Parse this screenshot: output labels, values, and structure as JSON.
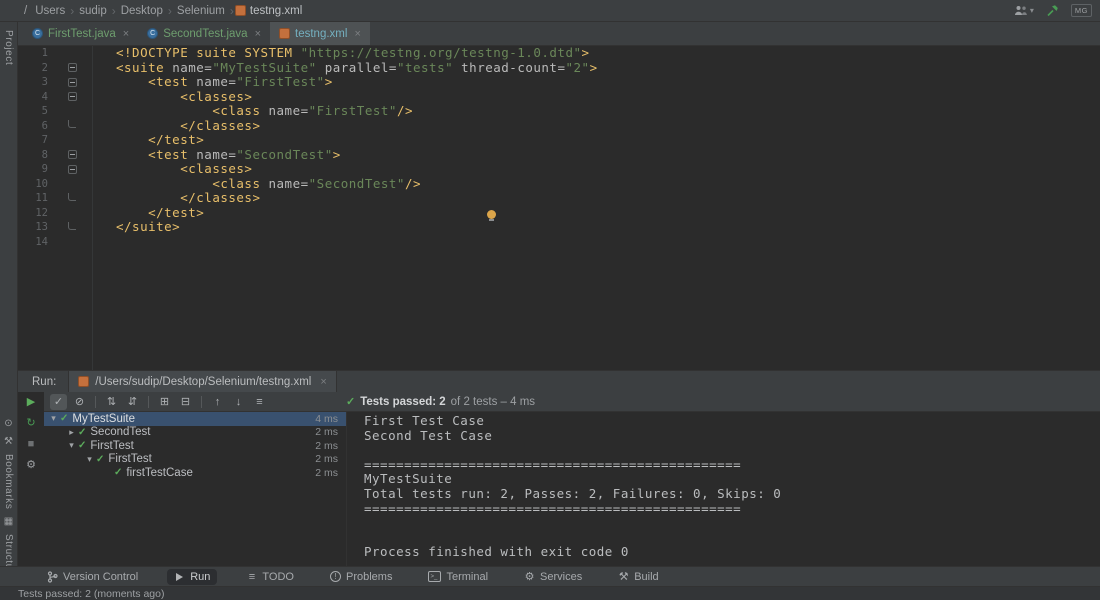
{
  "breadcrumb": {
    "items": [
      "/",
      "Users",
      "sudip",
      "Desktop",
      "Selenium",
      "testng.xml"
    ]
  },
  "top_right": {
    "badge": "MG"
  },
  "tabs": [
    {
      "label": "FirstTest.java",
      "icon": "class",
      "active": false,
      "label_color": "#6e9e6e"
    },
    {
      "label": "SecondTest.java",
      "icon": "class",
      "active": false,
      "label_color": "#6e9e6e"
    },
    {
      "label": "testng.xml",
      "icon": "testng",
      "active": true,
      "label_color": "#74b0c0"
    }
  ],
  "stripe": {
    "top_label": "Project",
    "bottom": [
      {
        "type": "icon",
        "name": "commit-icon",
        "glyph": "⊙"
      },
      {
        "type": "icon",
        "name": "build-icon",
        "glyph": "⚒"
      },
      {
        "type": "label",
        "name": "tool-stripe-bookmarks",
        "text": "Bookmarks"
      },
      {
        "type": "icon",
        "name": "layers-icon",
        "glyph": "▦"
      },
      {
        "type": "label",
        "name": "tool-stripe-structure",
        "text": "Structure"
      }
    ]
  },
  "editor": {
    "lines": [
      {
        "num": "1",
        "fold": "",
        "tokens": [
          [
            "tag",
            "<!DOCTYPE suite SYSTEM "
          ],
          [
            "str",
            "\"https://testng.org/testng-1.0.dtd\""
          ],
          [
            "tag",
            ">"
          ]
        ]
      },
      {
        "num": "2",
        "fold": "minus",
        "tokens": [
          [
            "tag",
            "<suite "
          ],
          [
            "attr",
            "name="
          ],
          [
            "str",
            "\"MyTestSuite\""
          ],
          [
            "attr",
            " parallel="
          ],
          [
            "str",
            "\"tests\""
          ],
          [
            "attr",
            " thread-count="
          ],
          [
            "str",
            "\"2\""
          ],
          [
            "tag",
            ">"
          ]
        ]
      },
      {
        "num": "3",
        "fold": "minus",
        "tokens": [
          [
            "plain",
            "    "
          ],
          [
            "tag",
            "<test "
          ],
          [
            "attr",
            "name="
          ],
          [
            "str",
            "\"FirstTest\""
          ],
          [
            "tag",
            ">"
          ]
        ]
      },
      {
        "num": "4",
        "fold": "minus",
        "tokens": [
          [
            "plain",
            "        "
          ],
          [
            "tag",
            "<classes>"
          ]
        ]
      },
      {
        "num": "5",
        "fold": "",
        "tokens": [
          [
            "plain",
            "            "
          ],
          [
            "tag",
            "<class "
          ],
          [
            "attr",
            "name="
          ],
          [
            "str",
            "\"FirstTest\""
          ],
          [
            "tag",
            "/>"
          ]
        ]
      },
      {
        "num": "6",
        "fold": "end",
        "tokens": [
          [
            "plain",
            "        "
          ],
          [
            "tag",
            "</classes>"
          ]
        ]
      },
      {
        "num": "7",
        "fold": "",
        "tokens": [
          [
            "plain",
            "    "
          ],
          [
            "tag",
            "</test>"
          ]
        ]
      },
      {
        "num": "8",
        "fold": "minus",
        "tokens": [
          [
            "plain",
            "    "
          ],
          [
            "tag",
            "<test "
          ],
          [
            "attr",
            "name="
          ],
          [
            "str",
            "\"SecondTest\""
          ],
          [
            "tag",
            ">"
          ]
        ]
      },
      {
        "num": "9",
        "fold": "minus",
        "tokens": [
          [
            "plain",
            "        "
          ],
          [
            "tag",
            "<classes>"
          ]
        ]
      },
      {
        "num": "10",
        "fold": "",
        "tokens": [
          [
            "plain",
            "            "
          ],
          [
            "tag",
            "<class "
          ],
          [
            "attr",
            "name="
          ],
          [
            "str",
            "\"SecondTest\""
          ],
          [
            "tag",
            "/>"
          ]
        ]
      },
      {
        "num": "11",
        "fold": "end",
        "tokens": [
          [
            "plain",
            "        "
          ],
          [
            "tag",
            "</classes>"
          ]
        ]
      },
      {
        "num": "12",
        "fold": "",
        "tokens": [
          [
            "plain",
            "    "
          ],
          [
            "tag",
            "</test>"
          ]
        ]
      },
      {
        "num": "13",
        "fold": "end",
        "tokens": [
          [
            "tag",
            "</suite>"
          ]
        ]
      },
      {
        "num": "14",
        "fold": "",
        "tokens": []
      }
    ]
  },
  "run_panel": {
    "header_label": "Run:",
    "tab": {
      "path": "/Users/sudip/Desktop/Selenium/testng.xml"
    },
    "toolbar_icons": [
      {
        "name": "show-passed-toggle",
        "glyph": "✓",
        "active": true
      },
      {
        "name": "show-ignored-toggle",
        "glyph": "⊘",
        "active": false
      },
      {
        "name": "separator"
      },
      {
        "name": "sort-alphabetically-button",
        "glyph": "⇅",
        "active": false
      },
      {
        "name": "sort-by-duration-button",
        "glyph": "⇵",
        "active": false
      },
      {
        "name": "separator"
      },
      {
        "name": "expand-all-button",
        "glyph": "⊞",
        "active": false
      },
      {
        "name": "collapse-all-button",
        "glyph": "⊟",
        "active": false
      },
      {
        "name": "separator"
      },
      {
        "name": "previous-failed-button",
        "glyph": "↑",
        "active": false
      },
      {
        "name": "next-failed-button",
        "glyph": "↓",
        "active": false
      },
      {
        "name": "test-history-button",
        "glyph": "≡",
        "active": false
      }
    ],
    "side_icons": [
      {
        "name": "rerun-tests-button",
        "glyph": "▶",
        "color": "#5cad5c"
      },
      {
        "name": "rerun-failed-button",
        "glyph": "↻",
        "color": "#499c54"
      },
      {
        "name": "stop-button",
        "glyph": "■",
        "color": "#6e7173"
      },
      {
        "name": "test-settings-button",
        "glyph": "⚙",
        "color": "#9da0a3"
      }
    ],
    "status": {
      "bold": "Tests passed: 2",
      "rest": "of 2 tests – 4 ms"
    },
    "tree": [
      {
        "depth": 0,
        "chevron": "down",
        "label": "MyTestSuite",
        "time": "4 ms",
        "selected": true
      },
      {
        "depth": 1,
        "chevron": "right",
        "label": "SecondTest",
        "time": "2 ms",
        "selected": false
      },
      {
        "depth": 1,
        "chevron": "down",
        "label": "FirstTest",
        "time": "2 ms",
        "selected": false
      },
      {
        "depth": 2,
        "chevron": "down",
        "label": "FirstTest",
        "time": "2 ms",
        "selected": false
      },
      {
        "depth": 3,
        "chevron": "none",
        "label": "firstTestCase",
        "time": "2 ms",
        "selected": false
      }
    ],
    "console": [
      "First Test Case",
      "Second Test Case",
      "",
      "===============================================",
      "MyTestSuite",
      "Total tests run: 2, Passes: 2, Failures: 0, Skips: 0",
      "===============================================",
      "",
      "",
      "Process finished with exit code 0"
    ]
  },
  "bottom_bar": {
    "items": [
      {
        "label": "Version Control",
        "icon": "branch",
        "active": false
      },
      {
        "label": "Run",
        "icon": "play",
        "active": true
      },
      {
        "label": "TODO",
        "icon": "todo",
        "active": false
      },
      {
        "label": "Problems",
        "icon": "problems",
        "active": false
      },
      {
        "label": "Terminal",
        "icon": "terminal",
        "active": false
      },
      {
        "label": "Services",
        "icon": "services",
        "active": false
      },
      {
        "label": "Build",
        "icon": "build",
        "active": false
      }
    ]
  },
  "status_bar": {
    "text": "Tests passed: 2 (moments ago)"
  },
  "colors": {
    "panel": "#3c3f41",
    "editor_bg": "#2b2b2b",
    "tag": "#e8bf6a",
    "string": "#6a8759",
    "selection": "#39516f",
    "pass_green": "#5cab5c"
  }
}
